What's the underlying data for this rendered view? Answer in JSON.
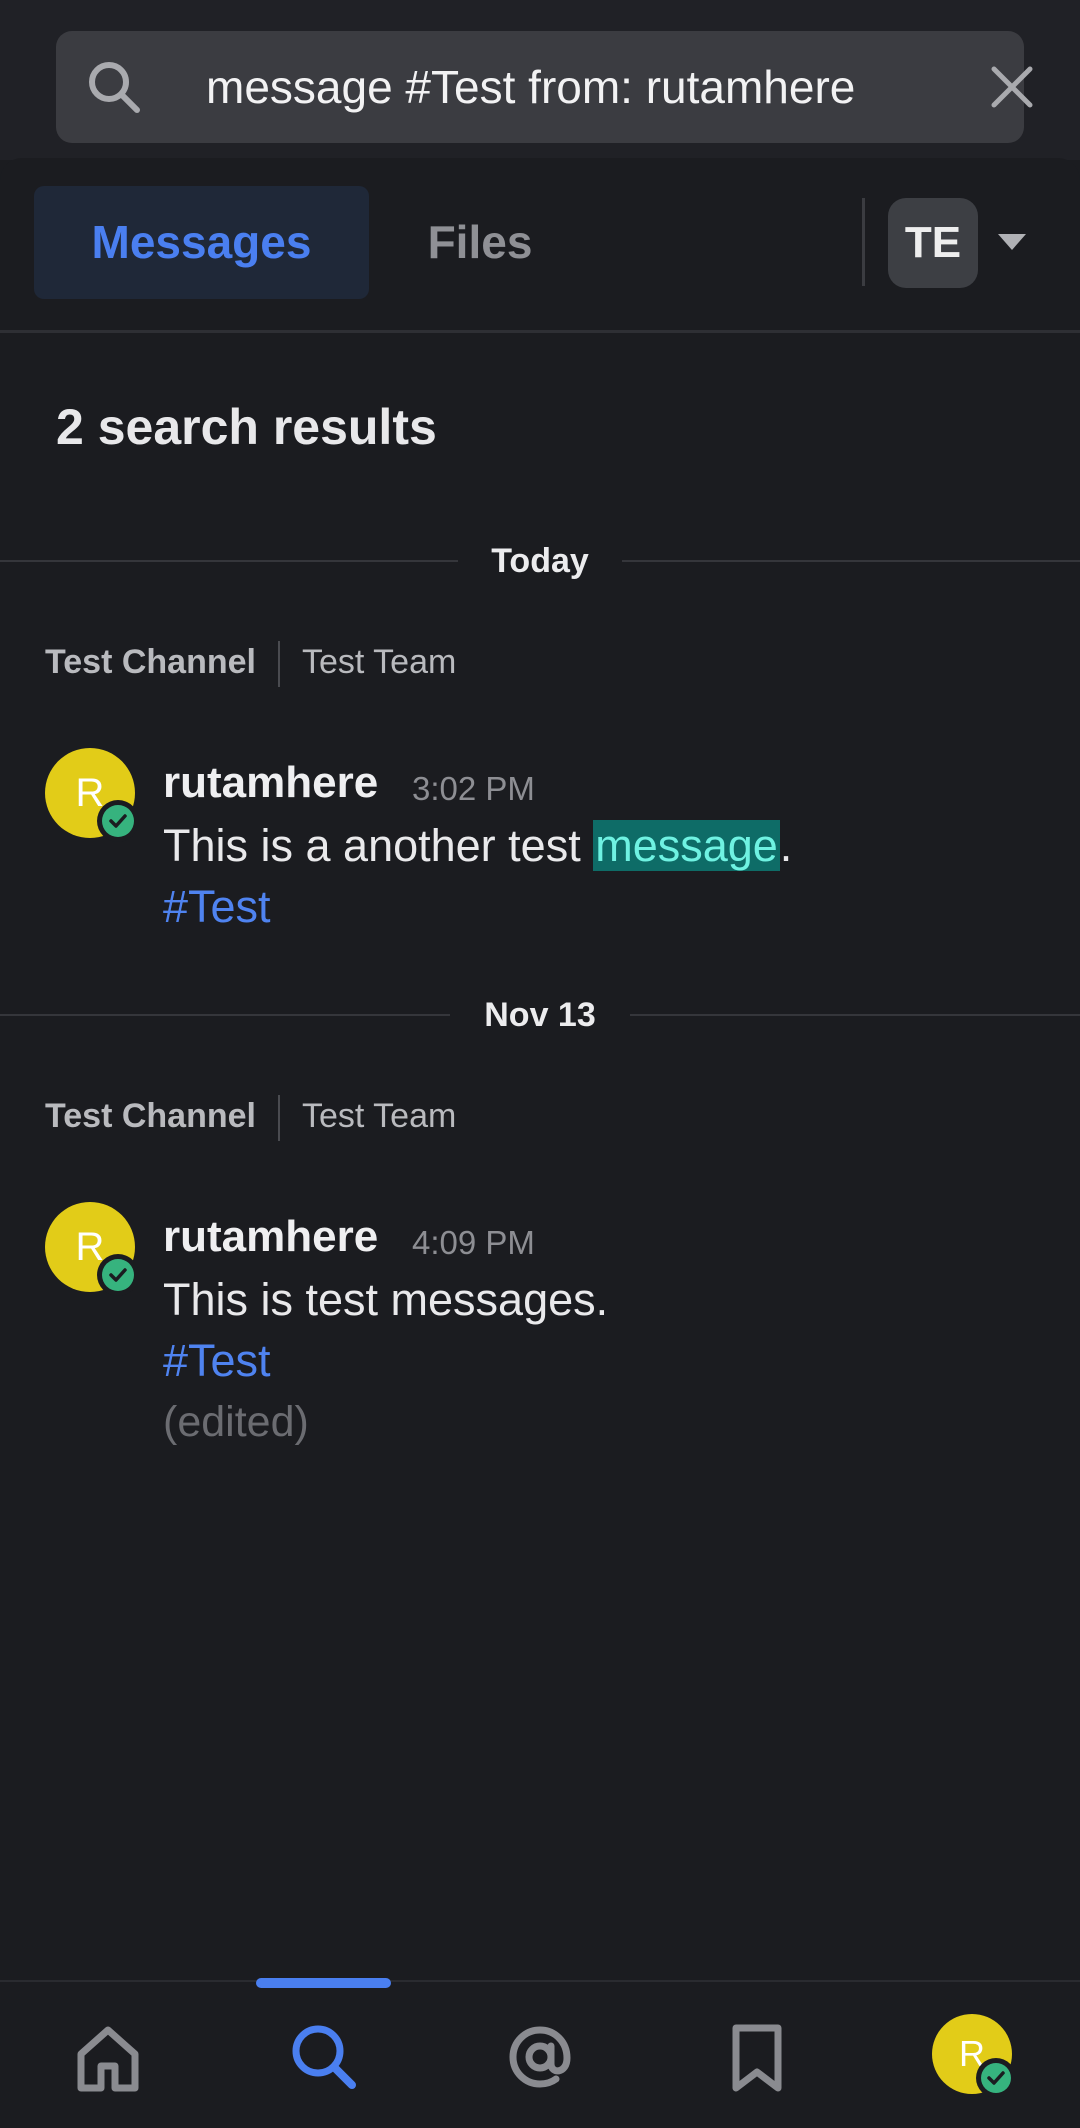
{
  "search": {
    "query": "message #Test from: rutamhere",
    "search_icon": "search-icon",
    "clear_icon": "close-icon"
  },
  "tabs": [
    {
      "label": "Messages",
      "active": true
    },
    {
      "label": "Files",
      "active": false
    }
  ],
  "team_selector": {
    "initials": "TE",
    "icon": "chevron-down-icon"
  },
  "results": {
    "count_text": "2 search results"
  },
  "groups": [
    {
      "date_label": "Today",
      "channel": "Test Channel",
      "team": "Test Team",
      "post": {
        "avatar_letter": "R",
        "author": "rutamhere",
        "time": "3:02 PM",
        "text_before": "This is a another test ",
        "highlight": "message",
        "text_after": ".",
        "hashtag": "#Test"
      }
    },
    {
      "date_label": "Nov 13",
      "channel": "Test Channel",
      "team": "Test Team",
      "post": {
        "avatar_letter": "R",
        "author": "rutamhere",
        "time": "4:09 PM",
        "text": "This is test messages.",
        "hashtag": "#Test",
        "edited": "(edited)"
      }
    }
  ],
  "bottom_nav": {
    "items": [
      "home-icon",
      "search-icon",
      "mentions-icon",
      "saved-icon",
      "profile-avatar"
    ],
    "active": "search-icon",
    "avatar_letter": "R"
  },
  "colors": {
    "accent": "#4a7ff0",
    "background": "#1b1c20",
    "avatar": "#e2cc18",
    "online": "#36b37e",
    "highlight_bg": "#0e6c67",
    "highlight_text": "#6ff2e2"
  }
}
